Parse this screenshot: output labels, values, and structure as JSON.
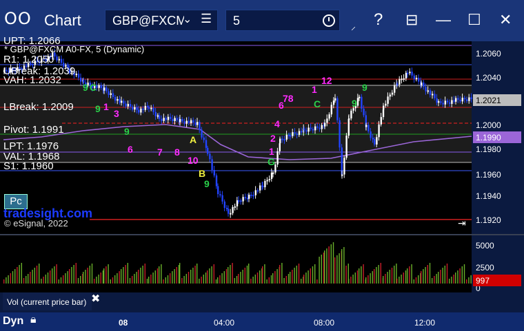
{
  "window": {
    "icon": "OO",
    "title": "Chart",
    "symbol": "GBP@FXCM",
    "interval": "5",
    "buttons": [
      "draw-icon",
      "help-icon",
      "layout-icon",
      "maximize-icon",
      "close-icon"
    ]
  },
  "chart": {
    "symbol_line": "* GBP@FXCM A0-FX, 5 (Dynamic)",
    "levels": [
      {
        "name": "UPT",
        "text": "UPT: 1.2066",
        "value": 1.2066,
        "color": "#8a5cf0"
      },
      {
        "name": "R1",
        "text": "R1: 1.2050",
        "value": 1.205,
        "color": "#3b5cff"
      },
      {
        "name": "UBreak",
        "text": "UBreak: 1.2039",
        "value": 1.2039,
        "color": "#d02020"
      },
      {
        "name": "VAH",
        "text": "VAH: 1.2032",
        "value": 1.2032,
        "color": "#c0c0c0"
      },
      {
        "name": "LBreak",
        "text": "LBreak: 1.2009",
        "value": 1.2009,
        "color": "#d02020"
      },
      {
        "name": "Pivot",
        "text": "Pivot: 1.1991",
        "value": 1.1991,
        "color": "#20a020"
      },
      {
        "name": "LPT",
        "text": "LPT: 1.1976",
        "value": 1.1976,
        "color": "#8a5cf0"
      },
      {
        "name": "VAL",
        "text": "VAL: 1.1968",
        "value": 1.1968,
        "color": "#c0c0c0"
      },
      {
        "name": "S1",
        "text": "S1: 1.1960",
        "value": 1.196,
        "color": "#3b5cff"
      }
    ],
    "price_ticks": [
      "1.2060",
      "1.2040",
      "1.2000",
      "1.1980",
      "1.1960",
      "1.1940",
      "1.1920"
    ],
    "last_price": "1.2021",
    "ma_price": "1.1990",
    "vol_ticks": [
      "5000",
      "2500",
      "0"
    ],
    "vol_value": "997",
    "vol_panel_label": "Vol (current price bar)",
    "watermark": "tradesight.com",
    "copyright": "© eSignal, 2022",
    "pc_button": "Pc"
  },
  "time_axis": {
    "dyn_label": "Dyn",
    "labels": [
      "08",
      "04:00",
      "08:00",
      "12:00"
    ]
  },
  "colors": {
    "up": "#ffffff",
    "down": "#2244ff",
    "bg": "#000000",
    "accent": "#1a3578"
  }
}
